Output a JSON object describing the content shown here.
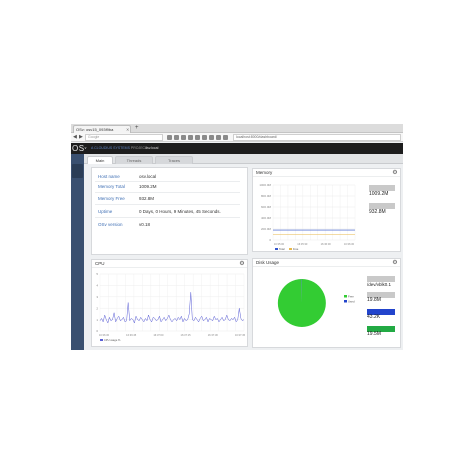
{
  "browser": {
    "tab_title": "OSv: osv15_093f9ba",
    "new_tab": "+",
    "search_placeholder": "Google",
    "address": "localhost:8000/dashboard/"
  },
  "header": {
    "logo": "OS",
    "logo_sup": "v",
    "tagline_brand": "A CLOUDIUS SYSTEMS",
    "tagline_rest": " PROJECT",
    "hostname": "osv.local"
  },
  "nav": {
    "tabs": [
      {
        "label": "Main",
        "active": true
      },
      {
        "label": "Threads",
        "active": false
      },
      {
        "label": "Traces",
        "active": false
      }
    ]
  },
  "info": {
    "rows": [
      {
        "key": "Host name",
        "value": "osv.local"
      },
      {
        "key": "Memory Total",
        "value": "1009.2M"
      },
      {
        "key": "Memory Free",
        "value": "932.8M"
      },
      {
        "key": "Uptime",
        "value": "0 Days, 0 Hours, 9 Minutes, 45 Seconds."
      },
      {
        "key": "OSv version",
        "value": "v0.18"
      }
    ]
  },
  "memory": {
    "title": "Memory",
    "total_value": "1009.2M",
    "free_value": "932.8M"
  },
  "cpu": {
    "title": "CPU"
  },
  "disk": {
    "title": "Disk Usage",
    "device": "/dev/vblk0.1",
    "free_value": "19.8M",
    "used_value": "43.2K",
    "available_value": "19.5M",
    "colors": {
      "free": "#33cc33",
      "used": "#2244cc",
      "available": "#22aa44"
    }
  },
  "chart_data": [
    {
      "type": "area",
      "panel": "memory",
      "y_ticks": [
        "1000.0M",
        "800.0M",
        "600.0M",
        "400.0M",
        "200.0M",
        "0"
      ],
      "x_ticks": [
        "16:35:00",
        "16:35:30",
        "16:36:00",
        "16:36:30"
      ],
      "ylim": [
        0,
        1000
      ],
      "series": [
        {
          "name": "Total",
          "color": "#3355cc",
          "values": [
            180,
            180,
            180,
            180,
            180,
            180,
            180,
            180
          ]
        },
        {
          "name": "Free",
          "color": "#e8b84a",
          "values": [
            100,
            100,
            100,
            100,
            100,
            100,
            100,
            100
          ]
        }
      ],
      "legend": "bottom-left"
    },
    {
      "type": "line",
      "panel": "cpu",
      "y_ticks": [
        "5",
        "4",
        "3",
        "2",
        "1",
        "0"
      ],
      "x_ticks": [
        "16:36:30",
        "16:36:45",
        "16:37:00",
        "16:37:15",
        "16:37:30",
        "16:37:45"
      ],
      "ylim": [
        0,
        5
      ],
      "series": [
        {
          "name": "CPU usage %",
          "color": "#5b5fd6",
          "values": [
            0.9,
            1.1,
            0.8,
            1.4,
            1.0,
            0.7,
            1.2,
            0.9,
            1.0,
            1.6,
            0.8,
            1.1,
            1.3,
            0.9,
            1.0,
            1.2,
            0.8,
            0.9,
            2.5,
            0.9,
            1.1,
            1.0,
            0.7,
            1.3,
            1.0,
            0.9,
            1.2,
            1.0,
            0.8,
            1.1,
            0.9,
            1.4,
            1.0,
            0.8,
            1.2,
            1.1,
            0.9,
            1.0,
            1.3,
            0.8,
            1.0,
            1.2,
            0.9,
            1.1,
            1.4,
            1.0,
            0.8,
            1.0,
            1.1,
            0.9,
            1.2,
            1.0,
            1.3,
            0.8,
            1.1,
            0.9,
            1.0,
            1.5,
            3.4,
            1.0,
            0.9,
            1.2,
            1.0,
            0.8,
            1.1,
            1.3,
            0.9,
            1.0,
            1.2,
            0.8,
            1.1,
            1.0,
            0.9,
            1.3,
            1.0,
            1.1,
            0.8,
            1.0,
            1.2,
            0.9,
            1.0,
            1.4,
            1.0,
            0.9,
            1.1,
            1.0,
            1.2,
            0.8,
            1.0,
            2.0,
            1.1,
            0.9,
            1.0
          ]
        }
      ],
      "legend": "bottom-left"
    },
    {
      "type": "pie",
      "panel": "disk",
      "slices": [
        {
          "name": "Free",
          "value": 99.8,
          "color": "#33cc33"
        },
        {
          "name": "Used",
          "value": 0.2,
          "color": "#2244cc"
        }
      ],
      "legend": "right"
    }
  ]
}
